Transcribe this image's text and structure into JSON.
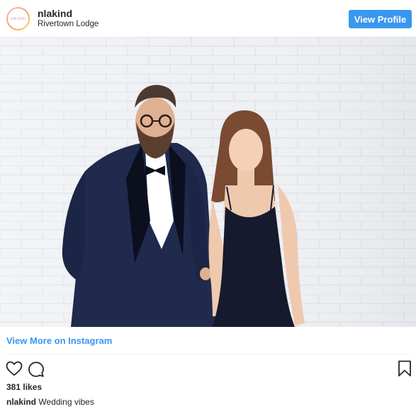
{
  "header": {
    "avatar_text": "AKIND",
    "username": "nlakind",
    "location": "Rivertown Lodge",
    "view_profile_label": "View Profile"
  },
  "photo": {
    "subject": "couple-portrait"
  },
  "link": {
    "view_more_label": "View More on Instagram"
  },
  "actions": {
    "like_icon": "heart-icon",
    "comment_icon": "comment-icon",
    "save_icon": "bookmark-icon"
  },
  "stats": {
    "likes": "381 likes"
  },
  "caption": {
    "username": "nlakind",
    "text": "Wedding vibes"
  },
  "colors": {
    "accent": "#3897f0",
    "text": "#262626",
    "divider": "#efefef"
  }
}
